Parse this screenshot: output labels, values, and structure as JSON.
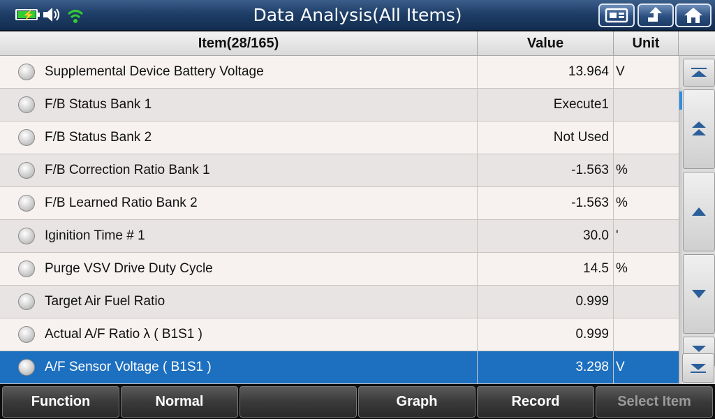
{
  "window": {
    "title": "Data Analysis(All Items)"
  },
  "status": {
    "battery_icon": "battery-charging-icon",
    "sound_icon": "speaker-icon",
    "wifi_icon": "wifi-icon",
    "wifi_color": "#33cc33"
  },
  "header_buttons": [
    {
      "icon": "screenshot-icon"
    },
    {
      "icon": "back-arrow-icon"
    },
    {
      "icon": "home-icon"
    }
  ],
  "table": {
    "columns": {
      "item": "Item(28/165)",
      "value": "Value",
      "unit": "Unit"
    },
    "rows": [
      {
        "item": "Supplemental Device Battery Voltage",
        "value": "13.964",
        "unit": "V"
      },
      {
        "item": "F/B Status Bank 1",
        "value": "Execute1",
        "unit": ""
      },
      {
        "item": "F/B Status Bank 2",
        "value": "Not Used",
        "unit": ""
      },
      {
        "item": "F/B Correction Ratio Bank 1",
        "value": "-1.563",
        "unit": "%"
      },
      {
        "item": "F/B Learned Ratio Bank 2",
        "value": "-1.563",
        "unit": "%"
      },
      {
        "item": "Iginition Time # 1",
        "value": "30.0",
        "unit": "'"
      },
      {
        "item": "Purge VSV Drive Duty Cycle",
        "value": "14.5",
        "unit": "%"
      },
      {
        "item": "Target Air Fuel Ratio",
        "value": "0.999",
        "unit": ""
      },
      {
        "item": "Actual A/F Ratio λ ( B1S1 )",
        "value": "0.999",
        "unit": ""
      },
      {
        "item": "A/F Sensor Voltage ( B1S1 )",
        "value": "3.298",
        "unit": "V"
      }
    ],
    "selected_index": 9,
    "selected_color": "#1d6fbf"
  },
  "scroll": {
    "buttons": [
      {
        "icon": "scroll-top-icon"
      },
      {
        "icon": "page-up-icon"
      },
      {
        "icon": "scroll-up-icon"
      },
      {
        "icon": "scroll-down-icon"
      },
      {
        "icon": "page-down-icon"
      },
      {
        "icon": "scroll-bottom-icon"
      }
    ]
  },
  "toolbar": {
    "buttons": [
      {
        "label": "Function",
        "enabled": true
      },
      {
        "label": "Normal",
        "enabled": true
      },
      {
        "label": "",
        "enabled": true
      },
      {
        "label": "Graph",
        "enabled": true
      },
      {
        "label": "Record",
        "enabled": true
      },
      {
        "label": "Select Item",
        "enabled": false
      }
    ]
  }
}
